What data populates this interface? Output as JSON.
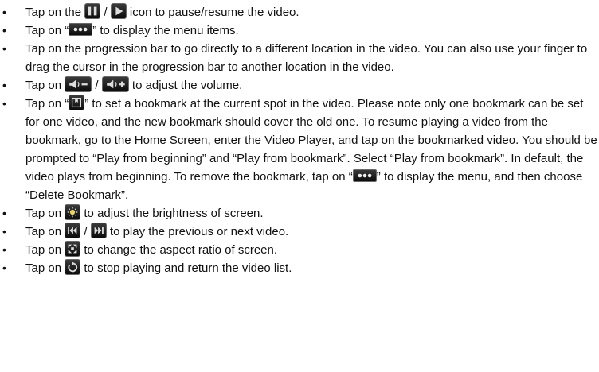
{
  "items": [
    {
      "before": "Tap on the ",
      "sep": " / ",
      "after": " icon to pause/resume the video."
    },
    {
      "before": "Tap on “",
      "after": "” to display the menu items."
    },
    {
      "text": "Tap on the progression bar to go directly to a different location in the video. You can also use your finger to drag the cursor in the progression bar to another location in the video."
    },
    {
      "before": "Tap on ",
      "sep": " / ",
      "after": " to adjust the volume."
    },
    {
      "before": "Tap on “",
      "after": "” to set a bookmark at the current spot in the video. Please note only one bookmark can be set for one video, and the new bookmark should cover the old one. To resume playing a video from the bookmark, go to the Home Screen, enter the Video Player, and tap on the bookmarked video. You should be prompted to “Play from beginning” and “Play from bookmark”. Select “Play from bookmark”. In default, the video plays from beginning. To remove the bookmark, tap on “",
      "after2": "” to display the menu, and then choose “Delete Bookmark”."
    },
    {
      "before": "Tap on ",
      "after": " to adjust the brightness of screen."
    },
    {
      "before": "Tap on ",
      "sep": " / ",
      "after": " to play the previous or next video."
    },
    {
      "before": "Tap on ",
      "after": " to change the aspect ratio of screen."
    },
    {
      "before": "Tap on ",
      "after": " to stop playing and return the video list."
    }
  ],
  "icons": {
    "pause": "pause-icon",
    "play": "play-icon",
    "menu": "menu-dots-icon",
    "volume_down": "volume-down-icon",
    "volume_up": "volume-up-icon",
    "bookmark": "bookmark-icon",
    "brightness": "brightness-icon",
    "previous": "previous-icon",
    "next": "next-icon",
    "aspect_ratio": "aspect-ratio-icon",
    "stop_return": "return-icon"
  }
}
